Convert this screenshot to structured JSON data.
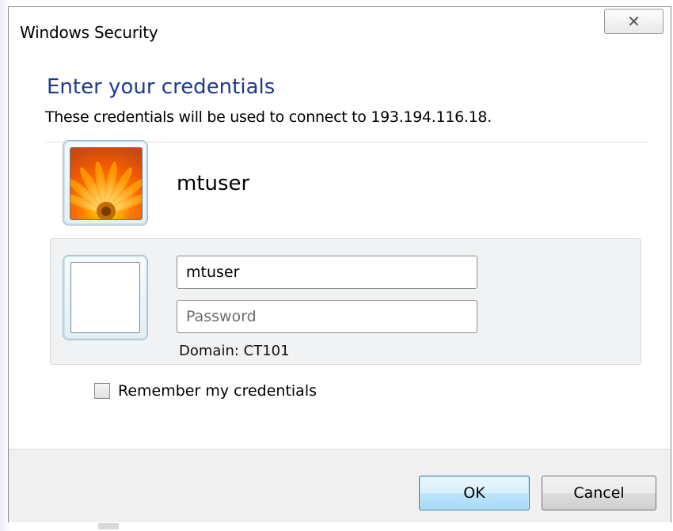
{
  "window": {
    "title": "Windows Security",
    "close_glyph": "✕"
  },
  "main": {
    "heading": "Enter your credentials",
    "subtext": "These credentials will be used to connect to 193.194.116.18.",
    "saved_user": {
      "name": "mtuser",
      "avatar_icon": "flower-avatar-icon"
    },
    "credential": {
      "tile_icon": "blank-user-tile-icon",
      "username_value": "mtuser",
      "password_value": "",
      "password_placeholder": "Password",
      "domain_text": "Domain: CT101"
    },
    "remember": {
      "label": "Remember my credentials",
      "checked": false
    }
  },
  "footer": {
    "ok_label": "OK",
    "cancel_label": "Cancel"
  },
  "colors": {
    "heading": "#1d3b8e",
    "ok_border": "#3c7fb1",
    "panel_bg": "#f1f2f3",
    "footer_bg": "#f0f0f0"
  }
}
